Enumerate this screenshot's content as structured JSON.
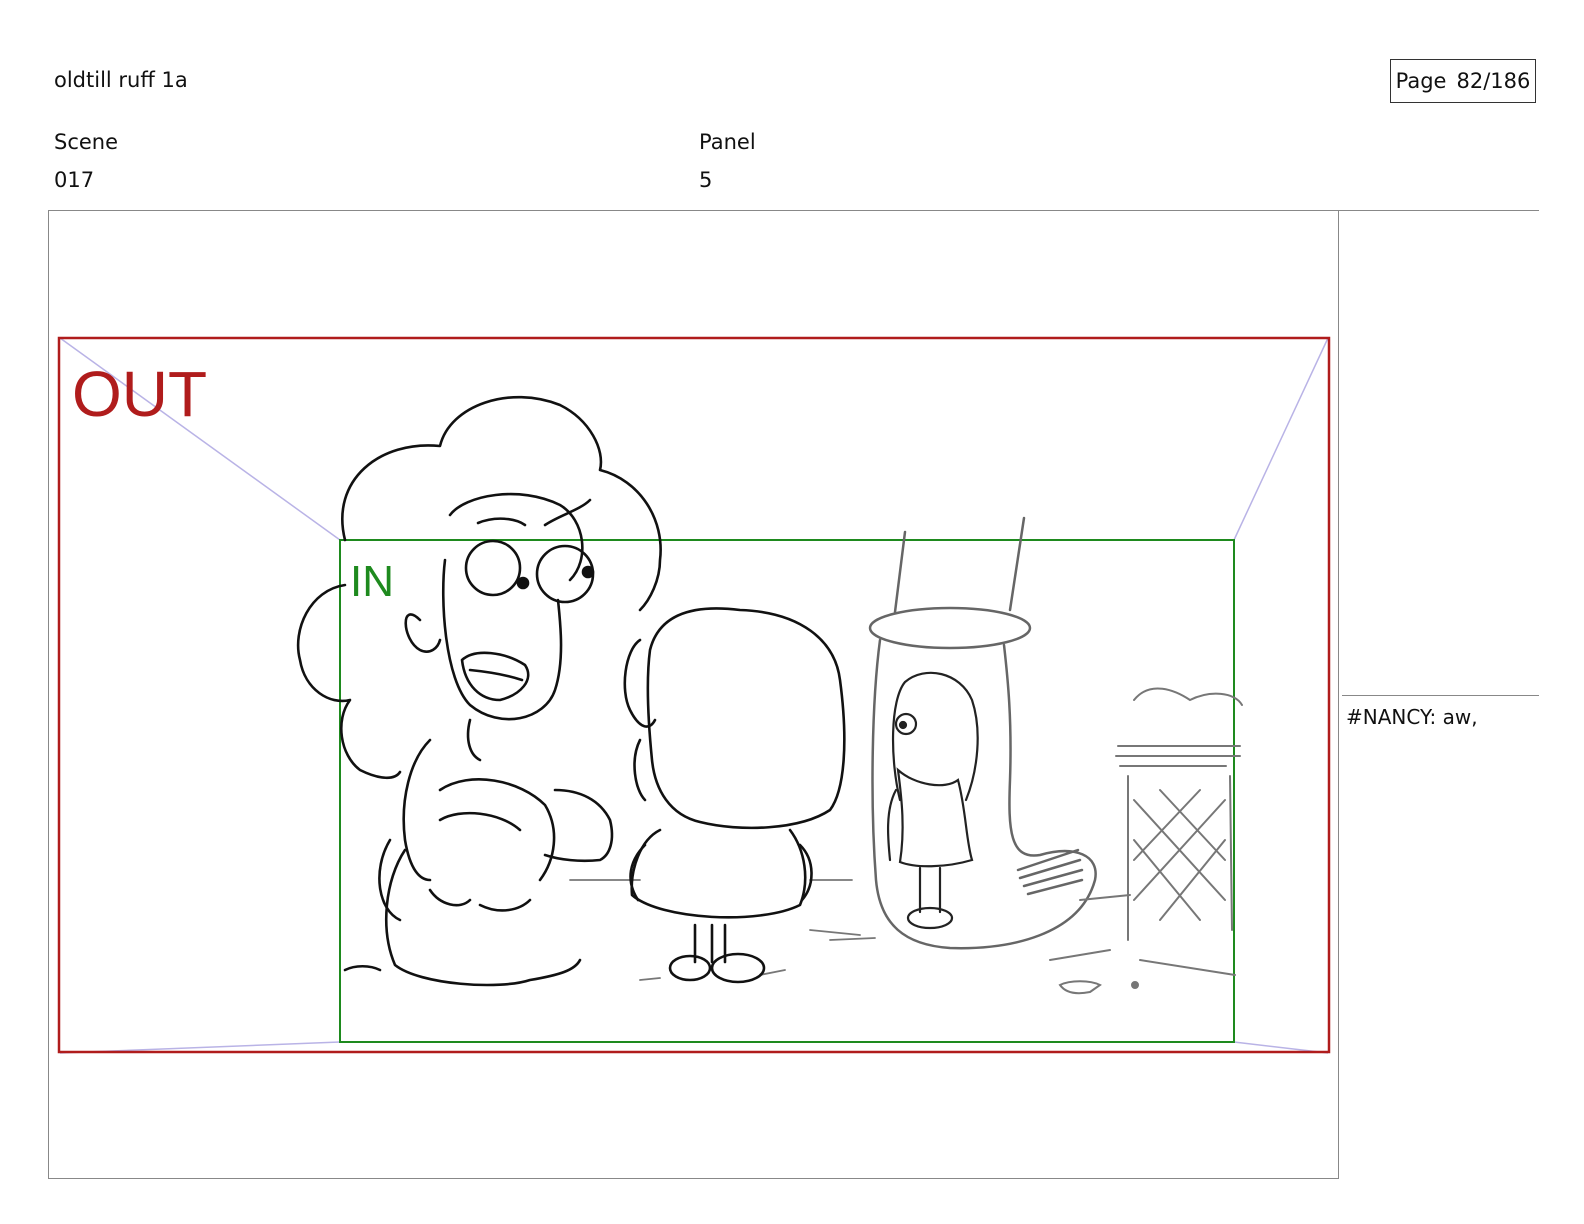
{
  "header": {
    "title": "oldtill ruff 1a",
    "page_label": "Page",
    "page_number": "82/186"
  },
  "scene": {
    "label": "Scene",
    "value": "017"
  },
  "panel": {
    "label": "Panel",
    "value": "5"
  },
  "safe_frames": {
    "out_label": "OUT",
    "in_label": "IN",
    "out_color": "#b01c1c",
    "in_color": "#1e8a1e"
  },
  "notes": {
    "dialogue": "#NANCY: aw,"
  }
}
